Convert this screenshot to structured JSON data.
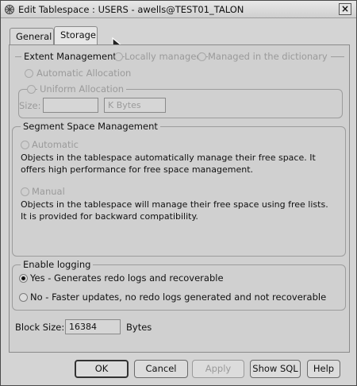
{
  "window": {
    "title": "Edit Tablespace : USERS - awells@TEST01_TALON"
  },
  "tabs": [
    {
      "label": "General",
      "selected": false
    },
    {
      "label": "Storage",
      "selected": true
    }
  ],
  "extent_management": {
    "legend": "Extent Management",
    "locally_managed": "Locally managed",
    "dictionary_managed": "Managed in the dictionary",
    "automatic_allocation": "Automatic Allocation",
    "uniform_allocation": "Uniform Allocation",
    "size_label": "Size:",
    "size_value": "",
    "size_unit": "K Bytes"
  },
  "segment_space": {
    "legend": "Segment Space Management",
    "automatic_label": "Automatic",
    "automatic_desc": "Objects in the tablespace automatically manage their free space. It offers high performance for free space management.",
    "manual_label": "Manual",
    "manual_desc": "Objects in the tablespace will manage their free space using free lists. It is provided for backward compatibility."
  },
  "logging": {
    "legend": "Enable logging",
    "yes_label": "Yes - Generates redo logs and recoverable",
    "no_label": "No - Faster updates, no redo logs generated and not recoverable",
    "selected": "yes"
  },
  "block_size": {
    "label": "Block Size:",
    "value": "16384",
    "unit": "Bytes"
  },
  "buttons": {
    "ok": "OK",
    "cancel": "Cancel",
    "apply": "Apply",
    "show_sql": "Show SQL",
    "help": "Help"
  },
  "icons": {
    "app": "oracle-app-icon",
    "close": "close-icon",
    "cursor": "mouse-pointer-icon"
  }
}
